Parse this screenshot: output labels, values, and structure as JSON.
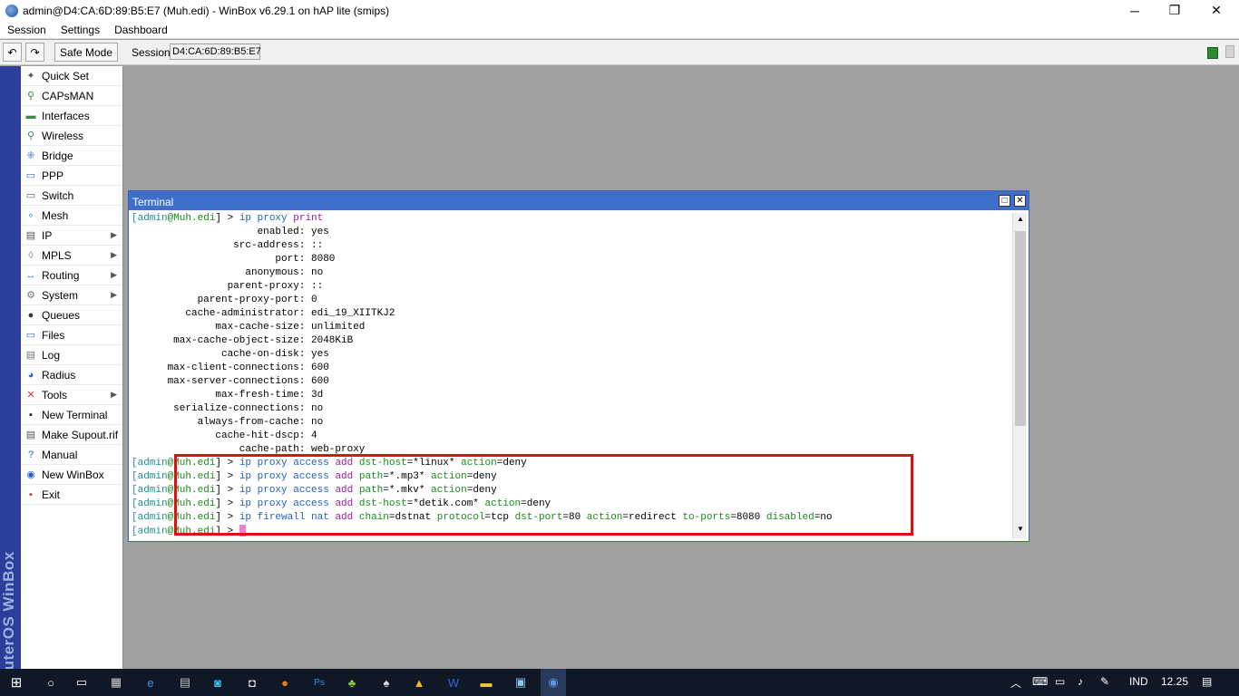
{
  "window": {
    "title": "admin@D4:CA:6D:89:B5:E7 (Muh.edi) - WinBox v6.29.1 on hAP lite (smips)",
    "minimize": "─",
    "restore": "❐",
    "close": "✕"
  },
  "menu": [
    "Session",
    "Settings",
    "Dashboard"
  ],
  "toolbar": {
    "undo": "↶",
    "redo": "↷",
    "safe_mode": "Safe Mode",
    "session_label": "Session:",
    "session_value": "D4:CA:6D:89:B5:E7"
  },
  "brand": "RouterOS WinBox",
  "sidebar": [
    {
      "label": "Quick Set",
      "icon": "quickset-icon",
      "arrow": ""
    },
    {
      "label": "CAPsMAN",
      "icon": "capsman-icon",
      "arrow": ""
    },
    {
      "label": "Interfaces",
      "icon": "interfaces-icon",
      "arrow": ""
    },
    {
      "label": "Wireless",
      "icon": "wireless-icon",
      "arrow": ""
    },
    {
      "label": "Bridge",
      "icon": "bridge-icon",
      "arrow": ""
    },
    {
      "label": "PPP",
      "icon": "ppp-icon",
      "arrow": ""
    },
    {
      "label": "Switch",
      "icon": "switch-icon",
      "arrow": ""
    },
    {
      "label": "Mesh",
      "icon": "mesh-icon",
      "arrow": ""
    },
    {
      "label": "IP",
      "icon": "ip-icon",
      "arrow": "▶"
    },
    {
      "label": "MPLS",
      "icon": "mpls-icon",
      "arrow": "▶"
    },
    {
      "label": "Routing",
      "icon": "routing-icon",
      "arrow": "▶"
    },
    {
      "label": "System",
      "icon": "system-icon",
      "arrow": "▶"
    },
    {
      "label": "Queues",
      "icon": "queues-icon",
      "arrow": ""
    },
    {
      "label": "Files",
      "icon": "files-icon",
      "arrow": ""
    },
    {
      "label": "Log",
      "icon": "log-icon",
      "arrow": ""
    },
    {
      "label": "Radius",
      "icon": "radius-icon",
      "arrow": ""
    },
    {
      "label": "Tools",
      "icon": "tools-icon",
      "arrow": "▶"
    },
    {
      "label": "New Terminal",
      "icon": "terminal-icon",
      "arrow": ""
    },
    {
      "label": "Make Supout.rif",
      "icon": "supout-icon",
      "arrow": ""
    },
    {
      "label": "Manual",
      "icon": "manual-icon",
      "arrow": ""
    },
    {
      "label": "New WinBox",
      "icon": "winbox-icon",
      "arrow": ""
    },
    {
      "label": "Exit",
      "icon": "exit-icon",
      "arrow": ""
    }
  ],
  "terminal": {
    "title": "Terminal",
    "prompt_user": "[admin",
    "prompt_host": "@Muh.edi",
    "prompt_end": "] > ",
    "print_cmd": [
      "ip proxy",
      " print"
    ],
    "settings": [
      {
        "key": "enabled",
        "value": "yes"
      },
      {
        "key": "src-address",
        "value": "::"
      },
      {
        "key": "port",
        "value": "8080"
      },
      {
        "key": "anonymous",
        "value": "no"
      },
      {
        "key": "parent-proxy",
        "value": "::"
      },
      {
        "key": "parent-proxy-port",
        "value": "0"
      },
      {
        "key": "cache-administrator",
        "value": "edi_19_XIITKJ2"
      },
      {
        "key": "max-cache-size",
        "value": "unlimited"
      },
      {
        "key": "max-cache-object-size",
        "value": "2048KiB"
      },
      {
        "key": "cache-on-disk",
        "value": "yes"
      },
      {
        "key": "max-client-connections",
        "value": "600"
      },
      {
        "key": "max-server-connections",
        "value": "600"
      },
      {
        "key": "max-fresh-time",
        "value": "3d"
      },
      {
        "key": "serialize-connections",
        "value": "no"
      },
      {
        "key": "always-from-cache",
        "value": "no"
      },
      {
        "key": "cache-hit-dscp",
        "value": "4"
      },
      {
        "key": "cache-path",
        "value": "web-proxy"
      }
    ],
    "commands": [
      {
        "path": "ip proxy access",
        "verb": " add",
        "args": [
          [
            "dst-host",
            "*linux*"
          ],
          [
            "action",
            "deny"
          ]
        ]
      },
      {
        "path": "ip proxy access",
        "verb": " add",
        "args": [
          [
            "path",
            "*.mp3*"
          ],
          [
            "action",
            "deny"
          ]
        ]
      },
      {
        "path": "ip proxy access",
        "verb": " add",
        "args": [
          [
            "path",
            "*.mkv*"
          ],
          [
            "action",
            "deny"
          ]
        ]
      },
      {
        "path": "ip proxy access",
        "verb": " add",
        "args": [
          [
            "dst-host",
            "*detik.com*"
          ],
          [
            "action",
            "deny"
          ]
        ]
      },
      {
        "path": "ip firewall nat",
        "verb": " add",
        "args": [
          [
            "chain",
            "dstnat"
          ],
          [
            "protocol",
            "tcp"
          ],
          [
            "dst-port",
            "80"
          ],
          [
            "action",
            "redirect"
          ],
          [
            "to-ports",
            "8080"
          ],
          [
            "disabled",
            "no"
          ]
        ]
      }
    ]
  },
  "taskbar": {
    "lang": "IND",
    "time": "12.25"
  },
  "colors": {
    "title_blue": "#3f6fc9",
    "brand_bar": "#2b3f9a",
    "highlight_red": "#e01010",
    "prompt_teal": "#1a8f8f",
    "keyword_green": "#1a8a1a",
    "arg_blue": "#2060c0",
    "cmd_purple": "#9a1a9a"
  }
}
